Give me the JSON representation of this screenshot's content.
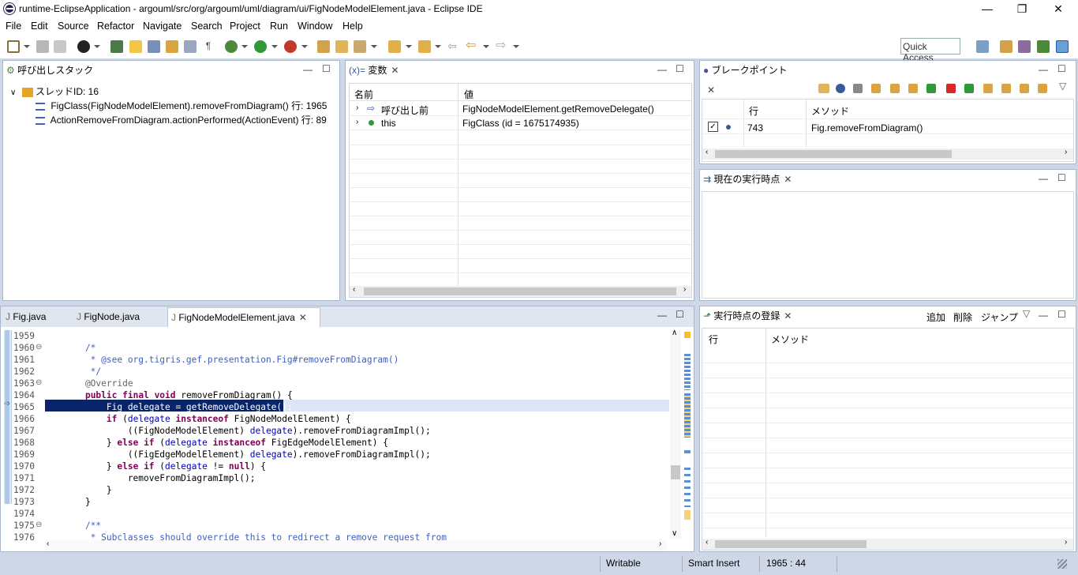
{
  "window": {
    "title": "runtime-EclipseApplication - argouml/src/org/argouml/uml/diagram/ui/FigNodeModelElement.java - Eclipse IDE",
    "minimize": "—",
    "restore": "❐",
    "close": "✕"
  },
  "menu": [
    "File",
    "Edit",
    "Source",
    "Refactor",
    "Navigate",
    "Search",
    "Project",
    "Run",
    "Window",
    "Help"
  ],
  "quick_access": "Quick Access",
  "callstack": {
    "tab": "呼び出しスタック",
    "thread": "スレッドID: 16",
    "frames": [
      "FigClass(FigNodeModelElement).removeFromDiagram() 行: 1965",
      "ActionRemoveFromDiagram.actionPerformed(ActionEvent) 行: 89"
    ]
  },
  "variables": {
    "tab_prefix": "(x)=",
    "tab": "変数",
    "col_name": "名前",
    "col_value": "値",
    "rows": [
      {
        "name": "呼び出し前",
        "value": "FigNodeModelElement.getRemoveDelegate()"
      },
      {
        "name": "this",
        "value": "FigClass (id = 1675174935)"
      }
    ]
  },
  "breakpoints": {
    "tab": "ブレークポイント",
    "col_line": "行",
    "col_method": "メソッド",
    "rows": [
      {
        "line": "743",
        "method": "Fig.removeFromDiagram()"
      }
    ]
  },
  "current_exec": {
    "tab": "現在の実行時点"
  },
  "exec_register": {
    "tab": "実行時点の登録",
    "actions": [
      "追加",
      "削除",
      "ジャンプ"
    ],
    "col_line": "行",
    "col_method": "メソッド"
  },
  "editor": {
    "tabs": [
      "Fig.java",
      "FigNode.java",
      "FigNodeModelElement.java"
    ],
    "active_tab": 2,
    "lines": [
      {
        "n": "1959",
        "t": ""
      },
      {
        "n": "1960",
        "t": "    /*"
      },
      {
        "n": "1961",
        "t": "     * @see org.tigris.gef.presentation.Fig#removeFromDiagram()"
      },
      {
        "n": "1962",
        "t": "     */"
      },
      {
        "n": "1963",
        "t": "    @Override"
      },
      {
        "n": "1964",
        "t": "    public final void removeFromDiagram() {"
      },
      {
        "n": "1965",
        "t": "        Fig delegate = getRemoveDelegate();"
      },
      {
        "n": "1966",
        "t": "        if (delegate instanceof FigNodeModelElement) {"
      },
      {
        "n": "1967",
        "t": "            ((FigNodeModelElement) delegate).removeFromDiagramImpl();"
      },
      {
        "n": "1968",
        "t": "        } else if (delegate instanceof FigEdgeModelElement) {"
      },
      {
        "n": "1969",
        "t": "            ((FigEdgeModelElement) delegate).removeFromDiagramImpl();"
      },
      {
        "n": "1970",
        "t": "        } else if (delegate != null) {"
      },
      {
        "n": "1971",
        "t": "            removeFromDiagramImpl();"
      },
      {
        "n": "1972",
        "t": "        }"
      },
      {
        "n": "1973",
        "t": "    }"
      },
      {
        "n": "1974",
        "t": ""
      },
      {
        "n": "1975",
        "t": "    /**"
      },
      {
        "n": "1976",
        "t": "     * Subclasses should override this to redirect a remove request from"
      }
    ]
  },
  "status": {
    "writable": "Writable",
    "insert": "Smart Insert",
    "position": "1965 : 44"
  },
  "colors": {
    "highlight": "#0a246a",
    "keyword": "#7f0055",
    "comment": "#3f5fbf",
    "field": "#0000c0"
  }
}
